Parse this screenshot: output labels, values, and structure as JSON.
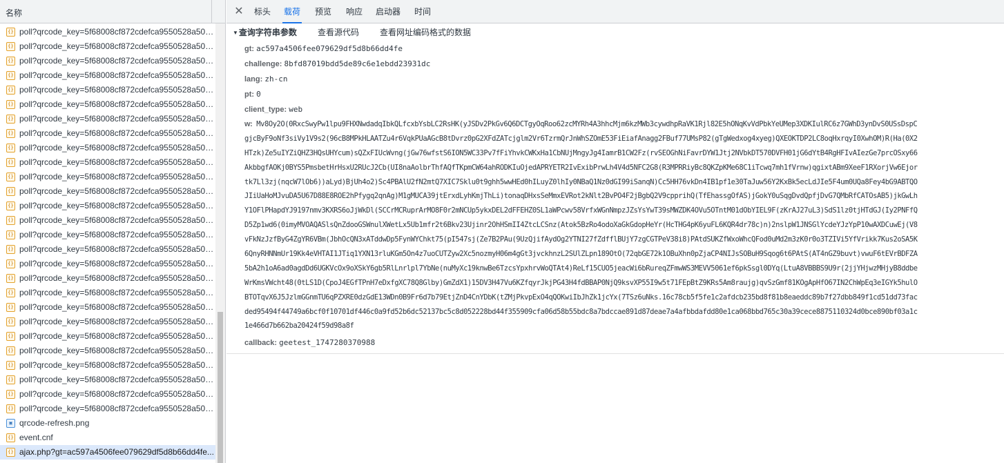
{
  "request_list": {
    "column_title": "名称",
    "items": [
      {
        "name": "poll?qrcode_key=5f68008cf872cdefca9550528a504f...",
        "type": "xhr"
      },
      {
        "name": "poll?qrcode_key=5f68008cf872cdefca9550528a504f...",
        "type": "xhr"
      },
      {
        "name": "poll?qrcode_key=5f68008cf872cdefca9550528a504f...",
        "type": "xhr"
      },
      {
        "name": "poll?qrcode_key=5f68008cf872cdefca9550528a504f...",
        "type": "xhr"
      },
      {
        "name": "poll?qrcode_key=5f68008cf872cdefca9550528a504f...",
        "type": "xhr"
      },
      {
        "name": "poll?qrcode_key=5f68008cf872cdefca9550528a504f...",
        "type": "xhr"
      },
      {
        "name": "poll?qrcode_key=5f68008cf872cdefca9550528a504f...",
        "type": "xhr"
      },
      {
        "name": "poll?qrcode_key=5f68008cf872cdefca9550528a504f...",
        "type": "xhr"
      },
      {
        "name": "poll?qrcode_key=5f68008cf872cdefca9550528a504f...",
        "type": "xhr"
      },
      {
        "name": "poll?qrcode_key=5f68008cf872cdefca9550528a504f...",
        "type": "xhr"
      },
      {
        "name": "poll?qrcode_key=5f68008cf872cdefca9550528a504f...",
        "type": "xhr"
      },
      {
        "name": "poll?qrcode_key=5f68008cf872cdefca9550528a504f...",
        "type": "xhr"
      },
      {
        "name": "poll?qrcode_key=5f68008cf872cdefca9550528a504f...",
        "type": "xhr"
      },
      {
        "name": "poll?qrcode_key=5f68008cf872cdefca9550528a504f...",
        "type": "xhr"
      },
      {
        "name": "poll?qrcode_key=5f68008cf872cdefca9550528a504f...",
        "type": "xhr"
      },
      {
        "name": "poll?qrcode_key=5f68008cf872cdefca9550528a504f...",
        "type": "xhr"
      },
      {
        "name": "poll?qrcode_key=5f68008cf872cdefca9550528a504f...",
        "type": "xhr"
      },
      {
        "name": "poll?qrcode_key=5f68008cf872cdefca9550528a504f...",
        "type": "xhr"
      },
      {
        "name": "poll?qrcode_key=5f68008cf872cdefca9550528a504f...",
        "type": "xhr"
      },
      {
        "name": "poll?qrcode_key=5f68008cf872cdefca9550528a504f...",
        "type": "xhr"
      },
      {
        "name": "poll?qrcode_key=5f68008cf872cdefca9550528a504f...",
        "type": "xhr"
      },
      {
        "name": "poll?qrcode_key=5f68008cf872cdefca9550528a504f...",
        "type": "xhr"
      },
      {
        "name": "poll?qrcode_key=5f68008cf872cdefca9550528a504f...",
        "type": "xhr"
      },
      {
        "name": "poll?qrcode_key=5f68008cf872cdefca9550528a504f...",
        "type": "xhr"
      },
      {
        "name": "poll?qrcode_key=5f68008cf872cdefca9550528a504f...",
        "type": "xhr"
      },
      {
        "name": "poll?qrcode_key=5f68008cf872cdefca9550528a504f...",
        "type": "xhr"
      },
      {
        "name": "poll?qrcode_key=5f68008cf872cdefca9550528a504f...",
        "type": "xhr"
      },
      {
        "name": "qrcode-refresh.png",
        "type": "img"
      },
      {
        "name": "event.cnf",
        "type": "xhr"
      },
      {
        "name": "ajax.php?gt=ac597a4506fee079629df5d8b66dd4fe...",
        "type": "xhr",
        "selected": true
      }
    ]
  },
  "tabs": {
    "close_glyph": "✕",
    "items": [
      "标头",
      "载荷",
      "预览",
      "响应",
      "启动器",
      "时间"
    ],
    "active": "载荷"
  },
  "payload": {
    "section_title": "查询字符串参数",
    "view_source_label": "查看源代码",
    "view_url_encoded_label": "查看网址编码格式的数据",
    "params": [
      {
        "key": "gt:",
        "value": "ac597a4506fee079629df5d8b66dd4fe"
      },
      {
        "key": "challenge:",
        "value": "8bfd87019bdd5de89c6e1ebdd23931dc"
      },
      {
        "key": "lang:",
        "value": "zh-cn"
      },
      {
        "key": "pt:",
        "value": "0"
      },
      {
        "key": "client_type:",
        "value": "web"
      }
    ],
    "w_key": "w:",
    "w_lines": [
      "Mv8Oy2O(0RxcSwyPw1lpu9FHXNwdadqIbkQLfcxbYsbLC2RsHK(yJSDv2PkGv6Q6DCTgyOqRoo62zcMYRh4A3hhcMjm6kzMWb3cywdhpRaVK1Rjl82E5hONqKvVdPbkYeUMep3XDKIulRC6z7GWhD3ynDvS0USsDspC",
      "gjcByF9oNf3siVy1V9s2(96cB8MPkHLAATZu4r6VqkPUaAGcB8tDvrz0pG2XFdZATcjglm2Vr6TzrmQrJnWhSZOmE53FiEiafAnagg2FBuf77UMsP82(gTgWedxog4xyeg)QXEOKTDP2LC8oqHxrqyI0XwhOM)R(Ha(0X2",
      "HTzk)Ze5uIYZiQHZ3HQsUHYcum)sQZxFIUcWvng(jGw76wfstS6ION5WC33Pv7fFiYhvkCWKxHa1CbNUjMngyJg4IamrB1CW2Fz(rvSEOGhNiFavrDYW1Jtj2NVbkDT570DVFH01jG6dYtB4RgHFIvAIezGe7prcOSxy66",
      "AkbbgfAOKj0BYS5PmsbetHrHsxU2RUcJ2Cb(UI8naAolbrThfAQfTKpmCW64ahRODKIuOjedAPRYETR2IvExibPrwLh4V4d5NFC2G8(R3MPRRiyBc8QKZpKMe68C1iTcwq7mh1fVrnw)qgixtABm9XeeF1RXorjVw6Ejor",
      "tk7Ll3zj(nqcW7lOb6))aLyd)BjUh4o2)Sc4PBAlU2fN2mtQ7XIC7Sklu0t9ghh5wwHEd0hILuyZ0lhIy0NBaQ1Nz0dGI99iSanqN)Cc5HH76vkDn4IB1pf1e30TaJuw56Y2KxBk5ecLdJIe5F4um0UQa8Fey4bG9ABTQO",
      "JIiUaHoMJvuDA5U67D88E8ROE2hPfygq2qnAg)M1gMUCA39jtErxdLyhKmjThLi)tonaqDHxsSeMmxEVRot2kNlt2BvPO4F2jBgbQ2V9cpprihQ(TfEhassgOfAS)jGokY0uSqgDvdQpfjDvG7QMbRfCATOsAB5)jkGwLh",
      "Y1OFlPHapdYJ9197nmv3KXRS6oJjWkDl(SCCrMCRuprArMO8F0r2mNCUp5ykxDEL2dFFEHZ0SL1aWPcwv58VrfxWGnNmpzJZsYsYwT39sMWZDK4OVu5OTntM01dObYIEL9F(zKrAJ27uL3)SdS1lz0tjHTdGJ(Iy2PNFfQ",
      "D5Zp1wd6(0imyMVOAQASlsQnZdooGSWnulXWetLx5Ub1mfr2t6Bkv23Ujinr2OhHSmII4ZtcLCSnz(Atok5BzRo4odoXaGkGdopHeYr(HcTHG4pK6yuFL6KQR4dr78c)n)2nslpW1JNSGlYcdeYJzYpP10wAXDCuwEj(V8",
      "vFkNzJzfByG4ZgYR6VBm(JbhOcQN3xATddwDp5FynWYChkt75(pI547sj(Ze7B2PAu(9UzQjifAydOg2YTNI27fZdfflBUjY7zgCGTPeV38i8)PAtdSUKZfWxoWhcQFod0uMd2m3zK0r0o3TZIVi5YfVrikk7Kus2oSA5K",
      "6QnyRHNNmUr19Kk4eVHTAI1JTiq1YXN13rluKGm5On4z7uoCUTZyw2Xc5nozmyH06m4gGt3jvckhnzL2SUlZLpn189OtO(72qbGE72k1OBuXhn0pZjaCP4NIJsSOBuH9Sqog6t6PAtS(AT4nGZ9buvt)vwuF6tEVrBDFZA",
      "5bA2h1oA6ad0agdDd6UGKVcOx9oXSkY6gb5RlLnrlpl7YbNe(nuMyXc19knwBe6TzcsYpxhrvWoQTAt4)ReLf15CUO5jeacWi6bRureqZFmwWS3MEVV5061ef6pkSsgl0DYq(LtuA8VBBBS9U9r(2jjYHjwzMHjyB8ddbe",
      "WrKmsVWcht48(0tLS1D(CpoJ4EGfTPnH7eDxfgXC78Q8Glby)GmZdX1)15DV3H47Vu6KZfqyrJkjPG43H4fdBBAP0NjQ9ksvXP55I9w5t71FEpBtZ9KRs5Am8raujg)qvSzGmf81KOgApHfO67IN2ChWpEq3eIGYk5hulO",
      "BTOTqvX6J5JzlmGGnmTU6qPZXRE0dzGdE13WDn0B9Fr6d7b79EtjZnD4CnYDbK(tZMjPkvpExO4qQOKwiIbJhZk1jcYx(7TSz6uNks.16c78cb5f5fe1c2afdcb235bd8f81b8eaeddc89b7f27dbb849f1cd51dd73fac",
      "ded95494f44749a6bcf0f10701df446c0a9fd52b6dc52137bc5c8d052228bd44f355909cfa06d58b55bdc8a7bdccae891d87deae7a4afbbdafdd80e1ca068bbd765c30a39cece8875110324d0bce890bf03a1c",
      "1e466d7b662ba20424f59d98a8f"
    ],
    "callback_key": "callback:",
    "callback_value": "geetest_1747280370988"
  }
}
